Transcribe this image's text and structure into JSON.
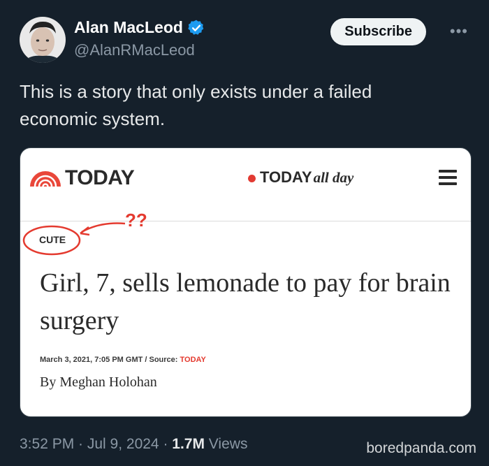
{
  "author": {
    "display_name": "Alan MacLeod",
    "handle": "@AlanRMacLeod",
    "verified_icon": "verified-badge-icon"
  },
  "actions": {
    "subscribe_label": "Subscribe",
    "more_label": "•••"
  },
  "tweet": {
    "text": "This is a story that only exists under a failed economic system."
  },
  "card": {
    "logo_text": "TODAY",
    "allday_bold": "TODAY",
    "allday_italic": "all day",
    "badge": "CUTE",
    "annotation": "??",
    "headline": "Girl, 7, sells lemonade to pay for brain surgery",
    "meta_prefix": "March 3, 2021, 7:05 PM GMT / Source: ",
    "meta_source": "TODAY",
    "byline": "By Meghan Holohan"
  },
  "footer": {
    "time": "3:52 PM · Jul 9, 2024 · ",
    "views_count": "1.7M",
    "views_label": " Views"
  },
  "watermark": "boredpanda.com",
  "colors": {
    "background": "#15202b",
    "verified": "#1d9bf0",
    "today_red": "#e43a2f"
  }
}
